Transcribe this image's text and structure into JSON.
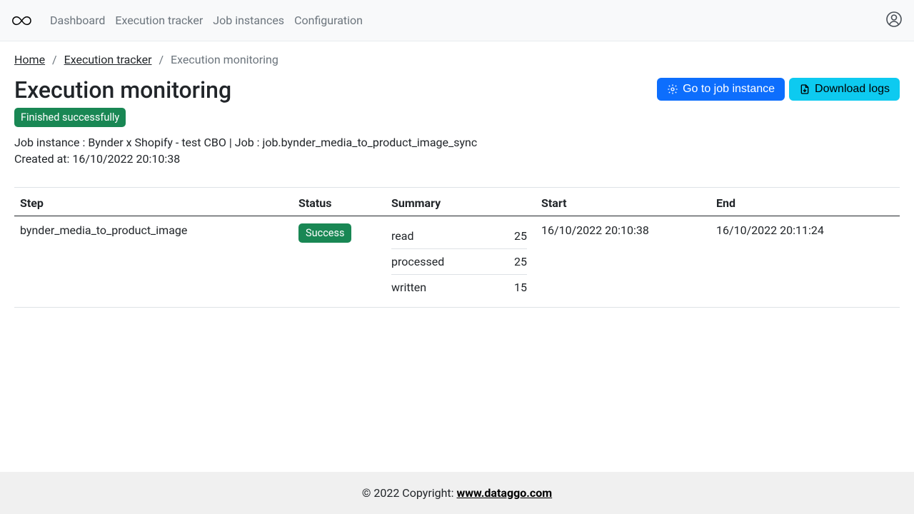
{
  "nav": {
    "items": [
      "Dashboard",
      "Execution tracker",
      "Job instances",
      "Configuration"
    ]
  },
  "breadcrumb": {
    "home": "Home",
    "tracker": "Execution tracker",
    "current": "Execution monitoring"
  },
  "page": {
    "title": "Execution monitoring",
    "status_badge": "Finished successfully",
    "meta_line1": "Job instance : Bynder x Shopify - test CBO | Job : job.bynder_media_to_product_image_sync",
    "meta_line2": "Created at: 16/10/2022 20:10:38"
  },
  "actions": {
    "go_to_instance": "Go to job instance",
    "download_logs": "Download logs"
  },
  "table": {
    "headers": {
      "step": "Step",
      "status": "Status",
      "summary": "Summary",
      "start": "Start",
      "end": "End"
    },
    "rows": [
      {
        "step": "bynder_media_to_product_image",
        "status": "Success",
        "summary": [
          {
            "label": "read",
            "value": "25"
          },
          {
            "label": "processed",
            "value": "25"
          },
          {
            "label": "written",
            "value": "15"
          }
        ],
        "start": "16/10/2022 20:10:38",
        "end": "16/10/2022 20:11:24"
      }
    ]
  },
  "footer": {
    "prefix": "© 2022 Copyright: ",
    "link_text": "www.dataggo.com"
  }
}
